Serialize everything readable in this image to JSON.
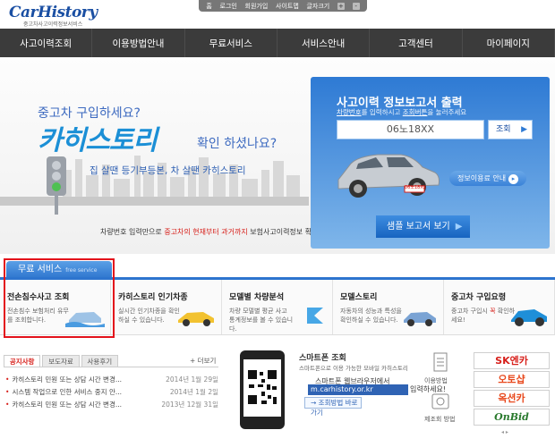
{
  "header": {
    "logo_text": "CarHistory",
    "logo_sub": "중고차사고이력정보서비스",
    "util": [
      "홈",
      "로그인",
      "회원가입",
      "사이트맵",
      "글자크기"
    ],
    "font_plus": "+",
    "font_minus": "-"
  },
  "nav": {
    "items": [
      "사고이력조회",
      "이용방법안내",
      "무료서비스",
      "서비스안내",
      "고객센터",
      "마이페이지"
    ]
  },
  "hero": {
    "line1": "중고차 구입하세요?",
    "brand": "카히스토리",
    "line2": "확인 하셨나요?",
    "tagline": "집 살땐 등기부등본, 차 살땐 카히스토리",
    "bottom_a": "차량번호 입력만으로 ",
    "bottom_red": "중고차의 현재부터 과거까지",
    "bottom_b": " 보험사고이력정보 확인이 가능합니다."
  },
  "report": {
    "title": "사고이력 정보보고서 출력",
    "sub_link1": "차량번호",
    "sub_mid": "를 입력하시고 ",
    "sub_link2": "조회버튼",
    "sub_end": "을 눌러주세요",
    "input_value": "06노18XX",
    "search_label": "조회",
    "guide_label": "정보이용료 안내",
    "sample_label": "샘플 보고서 보기",
    "plate": "06노18XX"
  },
  "free": {
    "tab_label": "무료 서비스",
    "tab_sub": "free service",
    "items": [
      {
        "title": "전손침수사고 조회",
        "desc": "전손침수 보험처리 유무를 조회합니다."
      },
      {
        "title": "카히스토리 인기차종",
        "desc": "실시간 인기차종을 확인하실 수 있습니다."
      },
      {
        "title": "모델별 차량분석",
        "desc": "차량 모델별 평균 사고 통계정보를 볼 수 있습니다."
      },
      {
        "title": "모델스토리",
        "desc": "자동차의 성능과 특성을 확인하실 수 있습니다."
      },
      {
        "title": "중고차 구입요령",
        "desc_a": "중고차 구입시 ",
        "desc_red": "꼭",
        "desc_b": " 확인하세요!"
      }
    ]
  },
  "news": {
    "tabs": [
      "공지사항",
      "보도자료",
      "사용후기"
    ],
    "more": "+ 더보기",
    "rows": [
      {
        "title": "카히스토리 민원 또는 상담 시간 변경...",
        "date": "2014년 1월 29일"
      },
      {
        "title": "시스템 작업으로 인한 서비스 중지 안...",
        "date": "2014년 1월 2일"
      },
      {
        "title": "카히스토리 민원 또는 상담 시간 변경...",
        "date": "2013년 12월 31일"
      }
    ]
  },
  "smartphone": {
    "title": "스마트폰 조회",
    "sub": "스마트폰으로 이용 가능한 모바일 카히스토리",
    "line": "스마트폰 웹브라우저에서",
    "url": "m.carhistory.or.kr",
    "url_tail": "입력하세요!",
    "button": "조회방법 바로가기"
  },
  "side": {
    "label1": "이용방법",
    "label2": "제조회 방법"
  },
  "banners": [
    {
      "label": "SK엔카",
      "color": "#d7201b"
    },
    {
      "label": "오토샵",
      "color": "#e8481c"
    },
    {
      "label": "옥션카",
      "color": "#e8481c"
    },
    {
      "label": "OnBid",
      "color": "#2a7a2e"
    }
  ],
  "colors": {
    "nav_bg": "#3b3b3b",
    "accent": "#2d74ce",
    "highlight": "#e3121b"
  }
}
